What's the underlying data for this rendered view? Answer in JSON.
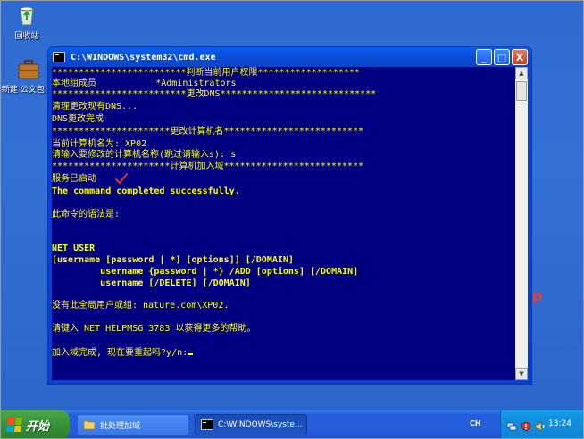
{
  "desktop": {
    "icons": [
      {
        "label": "回收站"
      },
      {
        "label": "新建 公文包"
      }
    ]
  },
  "window": {
    "title": "C:\\WINDOWS\\system32\\cmd.exe",
    "minimize_glyph": "_",
    "maximize_glyph": "□",
    "close_glyph": "X",
    "console_lines": [
      "*************************判断当前用户权限*******************",
      "本地组成员           *Administrators",
      "*************************更改DNS*****************************",
      "清理更改现有DNS...",
      "DNS更改完成",
      "**********************更改计算机名**************************",
      "当前计算机名为: XP02",
      "请输入要修改的计算机名称(跳过请输入s): s",
      "**********************计算机加入域**************************",
      "服务已启动",
      "The command completed successfully.",
      "",
      "此命令的语法是:",
      "",
      "",
      "NET USER",
      "[username [password | *] [options]] [/DOMAIN]",
      "         username {password | *} /ADD [options] [/DOMAIN]",
      "         username [/DELETE] [/DOMAIN]",
      "",
      "没有此全局用户或组: nature.com\\XP02.",
      "",
      "请键入 NET HELPMSG 3783 以获得更多的帮助。",
      "",
      "加入域完成, 现在要重起吗?y/n:"
    ],
    "checkmark": "✓"
  },
  "background_text": "p",
  "taskbar": {
    "start_label": "开始",
    "tasks": [
      {
        "label": "批处理加域"
      },
      {
        "label": "C:\\WINDOWS\\syste..."
      }
    ],
    "language": "CH",
    "clock": "13:24"
  },
  "colors": {
    "console_bg": "#000080",
    "console_text": "#FFFF00",
    "title_blue": "#0A4FD8",
    "taskbar_blue": "#245DDC",
    "start_green": "#3A963A",
    "tray_blue": "#1292E2",
    "check_red": "#E0322A"
  }
}
